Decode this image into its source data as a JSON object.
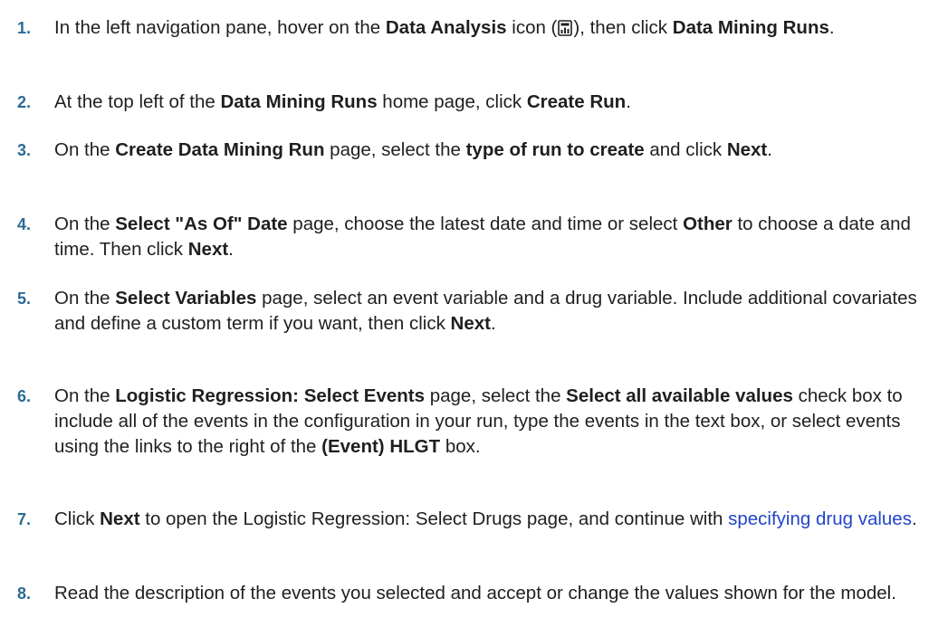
{
  "steps": [
    {
      "number": "1.",
      "p1": "In the left navigation pane, hover on the ",
      "b1": "Data Analysis",
      "p2": " icon (",
      "icon": "data-analysis-icon",
      "p3": "), then click ",
      "b2": "Data Mining Runs",
      "p4": "."
    },
    {
      "number": "2.",
      "p1": "At the top left of the ",
      "b1": "Data Mining Runs",
      "p2": " home page, click ",
      "b2": "Create Run",
      "p3": "."
    },
    {
      "number": "3.",
      "p1": "On the ",
      "b1": "Create Data Mining Run",
      "p2": " page, select the ",
      "b2": "type of run to create",
      "p3": " and click ",
      "b3": "Next",
      "p4": "."
    },
    {
      "number": "4.",
      "p1": "On the ",
      "b1": "Select \"As Of\" Date",
      "p2": " page, choose the latest date and time or select ",
      "b2": "Other",
      "p3": " to choose a date and time. Then click ",
      "b3": "Next",
      "p4": "."
    },
    {
      "number": "5.",
      "p1": "On the ",
      "b1": "Select Variables",
      "p2": " page, select an event variable and a drug variable. Include additional covariates and define a custom term if you want, then click ",
      "b2": "Next",
      "p3": "."
    },
    {
      "number": "6.",
      "p1": "On the ",
      "b1": "Logistic Regression: Select Events",
      "p2": " page, select the ",
      "b2": "Select all available values",
      "p3": " check box to include all of the events in the configuration in your run, type the events in the text box, or select events using the links to the right of the ",
      "b3": "(Event) HLGT",
      "p4": " box."
    },
    {
      "number": "7.",
      "p1": "Click ",
      "b1": "Next",
      "p2": " to open the Logistic Regression: Select Drugs page, and continue with ",
      "link": "specifying drug values",
      "p3": "."
    },
    {
      "number": "8.",
      "p1": "Read the description of the events you selected and accept or change the values shown for the model."
    }
  ],
  "colors": {
    "number": "#2c6b94",
    "text": "#1f1f1f",
    "link": "#2245c9"
  }
}
